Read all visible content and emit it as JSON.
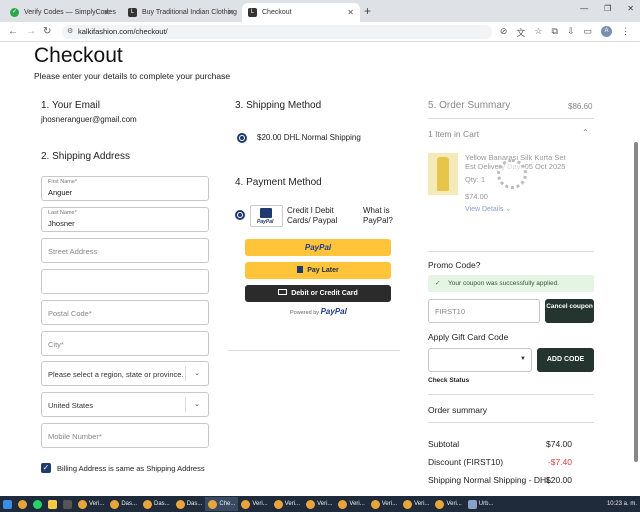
{
  "browser": {
    "tabs": [
      {
        "label": "Verify Codes — SimplyCodes"
      },
      {
        "label": "Buy Traditional Indian Clothing"
      },
      {
        "label": "Checkout"
      }
    ],
    "url": "kalkifashion.com/checkout/"
  },
  "page": {
    "title": "Checkout",
    "subtitle": "Please enter your details to complete your purchase"
  },
  "email": {
    "heading": "1.  Your Email",
    "value": "jhosneranguer@gmail.com"
  },
  "shipping_address": {
    "heading": "2.  Shipping Address",
    "first_name_label": "First Name*",
    "first_name": "Anguer",
    "last_name_label": "Last Name*",
    "last_name": "Jhosner",
    "street_placeholder": "Street Address",
    "postal_placeholder": "Postal Code*",
    "city_placeholder": "City*",
    "region_placeholder": "Please select a region, state or province.",
    "country": "United States",
    "mobile_placeholder": "Mobile Number*",
    "billing_same_label": "Billing Address is same as Shipping Address"
  },
  "shipping_method": {
    "heading": "3.  Shipping Method",
    "option": "$20.00  DHL  Normal Shipping"
  },
  "payment_method": {
    "heading": "4.  Payment Method",
    "option": "Credit I Debit Cards/ Paypal",
    "what_is": "What is PayPal?",
    "paypal_label": "PayPal",
    "paylater_label": "Pay Later",
    "card_label": "Debit or Credit Card",
    "powered_by": "Powered by",
    "powered_brand": "PayPal"
  },
  "order_summary": {
    "heading": "5.  Order Summary",
    "header_total": "$86.60",
    "items_in_cart": "1 Item in Cart",
    "item": {
      "name": "Yellow Banarasi Silk Kurta Set",
      "delivery": "Est Delivery Day: 05 Oct 2025",
      "qty_label": "Qty:",
      "qty": "1",
      "price": "$74.00",
      "view_details": "View Details"
    },
    "promo_heading": "Promo Code?",
    "promo_success": "Your coupon was successfully applied.",
    "promo_value": "FIRST10",
    "cancel_coupon": "Cancel coupon",
    "gift_heading": "Apply Gift Card Code",
    "add_code": "ADD CODE",
    "check_status": "Check Status",
    "summary_heading": "Order summary",
    "rows": [
      {
        "label": "Subtotal",
        "value": "$74.00"
      },
      {
        "label": "Discount (FIRST10)",
        "value": "-$7.40"
      },
      {
        "label": "Shipping Normal Shipping - DHL",
        "value": "$20.00"
      }
    ]
  },
  "taskbar": {
    "clock": "10:23 a. m.",
    "items": [
      "Veri...",
      "Das...",
      "Das...",
      "Das...",
      "Che...",
      "Veri...",
      "Veri...",
      "Veri...",
      "Veri...",
      "Veri...",
      "Veri...",
      "Veri...",
      "Urb..."
    ]
  },
  "colors": {
    "accent_navy": "#1e3a6e",
    "dark_button": "#24352f",
    "paypal_yellow": "#ffc439",
    "discount_red": "#d0453c",
    "success_bg": "#e6f4e6"
  }
}
